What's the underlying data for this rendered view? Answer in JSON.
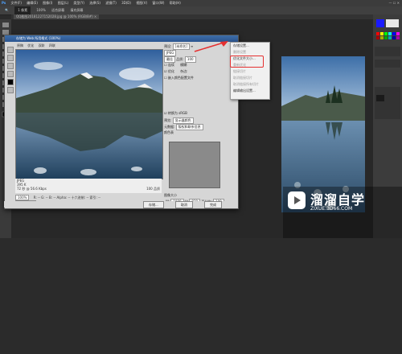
{
  "menubar": {
    "logo": "Ps",
    "items": [
      "文件(F)",
      "编辑(E)",
      "图像(I)",
      "图层(L)",
      "类型(Y)",
      "选择(S)",
      "滤镜(T)",
      "3D(D)",
      "视图(V)",
      "窗口(W)",
      "帮助(H)"
    ],
    "window_controls": "— ☐ ✕"
  },
  "options_bar": {
    "zoom": "1 像素",
    "items": [
      "100%",
      "适合屏幕",
      "填充屏幕"
    ]
  },
  "tabs": {
    "doc_tab": "QQ截图20181227152028.jpg @ 100% (RGB/8#) ×"
  },
  "dialog": {
    "title": "存储为 Web 所用格式 (100%)",
    "tabs": [
      "原稿",
      "优化",
      "双联",
      "四联"
    ],
    "preset_label": "预设:",
    "preset_value": "[未命名]",
    "format_value": "JPEG",
    "quality_select": "最佳",
    "quality_label": "品质:",
    "quality_value": "100",
    "check_continuous": "连续",
    "check_optimized": "优化",
    "check_embed_profile": "嵌入颜色配置文件",
    "blur_label": "模糊:",
    "matte_label": "杂边:",
    "convert_srgb": "转换为 sRGB",
    "preview_label": "预览:",
    "preview_value": "显示器颜色",
    "metadata_label": "元数据:",
    "metadata_value": "版权和联系信息",
    "color_table_label": "颜色表",
    "image_size_label": "图像大小",
    "width_label": "W:",
    "width_value": "1000",
    "height_label": "H:",
    "height_value": "929",
    "percent_label": "百分比:",
    "percent_value": "100",
    "quality_resample": "品质:",
    "resample_value": "两次立方",
    "animation_label": "动画",
    "info_format": "JPEG",
    "info_size": "395 K",
    "info_time": "72 秒 @ 56.6 Kbps",
    "info_quality": "100 品质",
    "zoom_value": "100%",
    "bottom_rgb": "R: --  G: --  B: --  Alpha: --  十六进制: --  索引: --",
    "btn_preview": "预览...",
    "btn_save": "存储...",
    "btn_cancel": "取消",
    "btn_done": "完成",
    "frame_info": "1/1"
  },
  "flyout": {
    "items": [
      {
        "label": "存储设置...",
        "disabled": false
      },
      {
        "label": "删除设置",
        "disabled": true
      },
      {
        "label": "优化文件大小...",
        "disabled": false
      },
      {
        "label": "重新优化",
        "disabled": true
      },
      {
        "label": "链接切片",
        "disabled": true
      },
      {
        "label": "取消链接切片",
        "disabled": true
      },
      {
        "label": "取消链接所有切片",
        "disabled": true
      },
      {
        "label": "编辑输出设置...",
        "disabled": false
      }
    ]
  },
  "watermark": {
    "title": "溜溜自学",
    "url": "ZIXUE.3D66.COM"
  }
}
